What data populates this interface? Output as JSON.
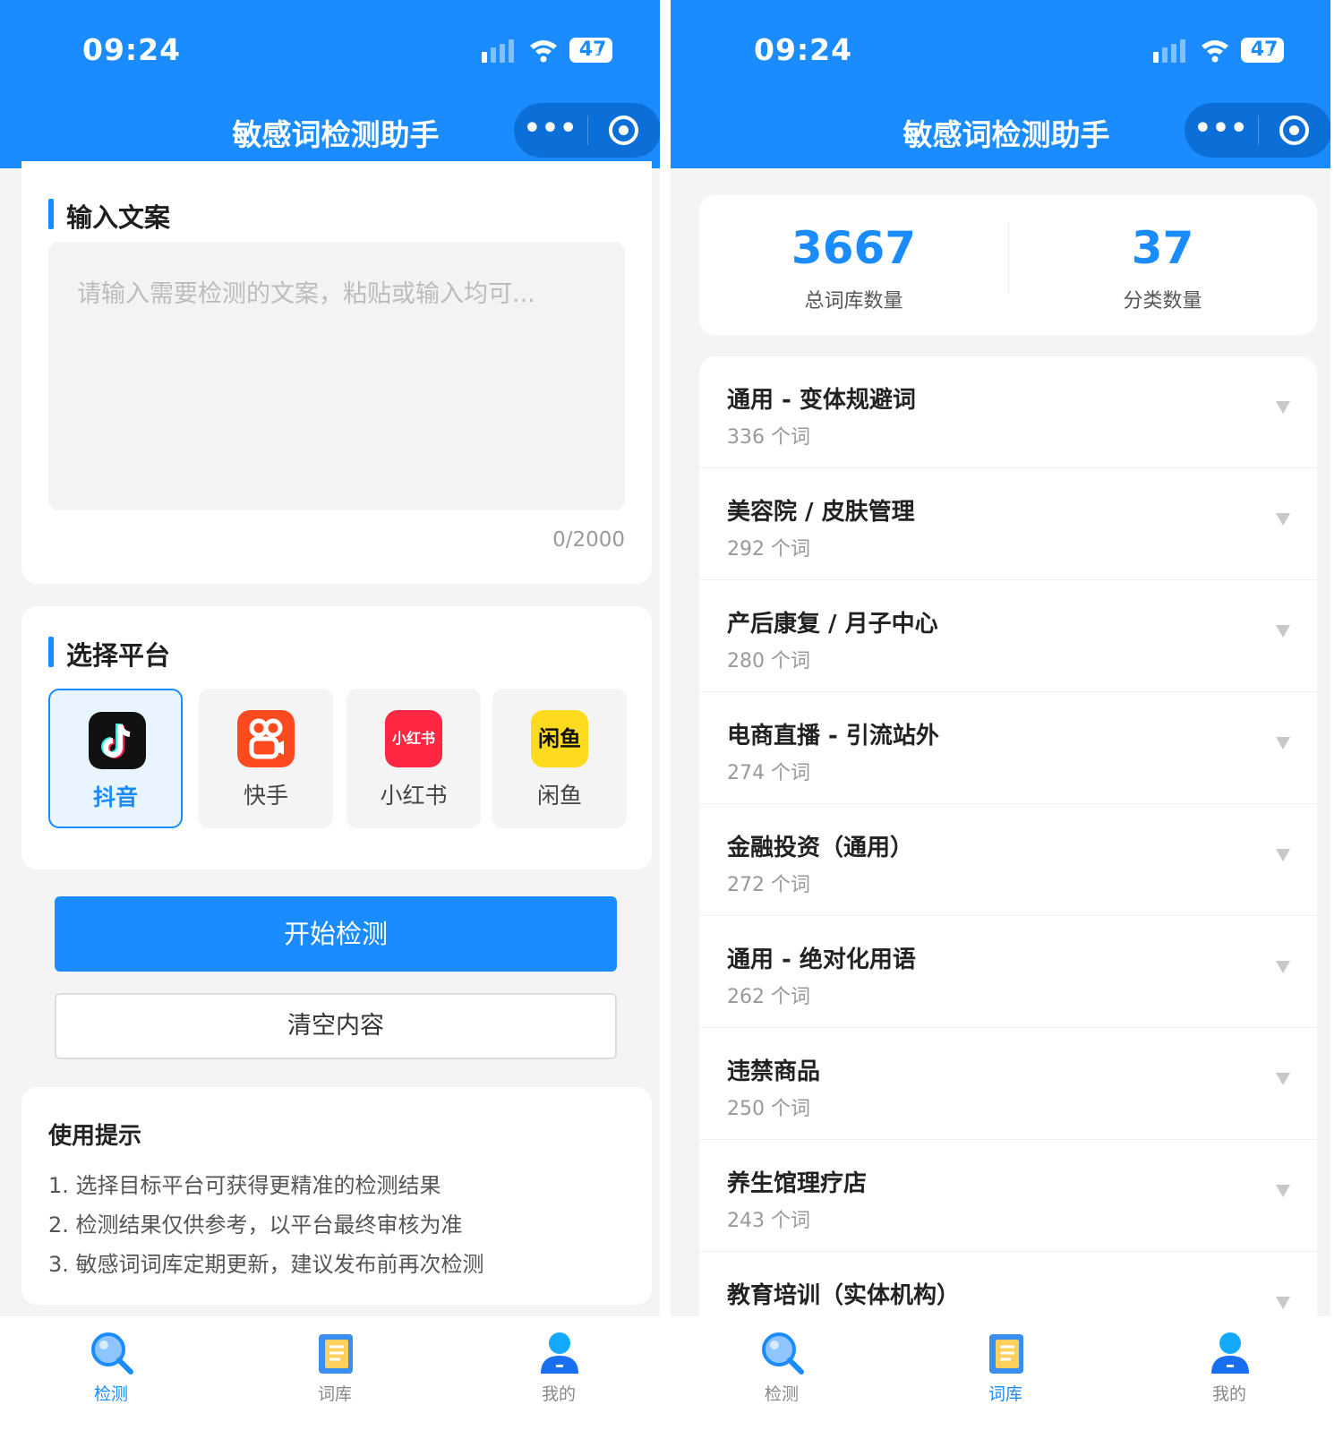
{
  "status": {
    "time": "09:24",
    "battery": "47"
  },
  "app_title": "敏感词检测助手",
  "capsule": {
    "more": "•••"
  },
  "detect": {
    "input_title": "输入文案",
    "placeholder": "请输入需要检测的文案，粘贴或输入均可...",
    "counter": "0/2000",
    "platform_title": "选择平台",
    "platforms": [
      {
        "name": "抖音",
        "icon": "douyin-icon",
        "active": true,
        "color": "#111111"
      },
      {
        "name": "快手",
        "icon": "kuaishou-icon",
        "active": false,
        "color": "#ff4a1f"
      },
      {
        "name": "小红书",
        "icon": "xiaohongshu-icon",
        "active": false,
        "color": "#ff2741",
        "logo_text": "小红书"
      },
      {
        "name": "闲鱼",
        "icon": "xianyu-icon",
        "active": false,
        "color": "#ffdb1f",
        "logo_text": "闲鱼"
      }
    ],
    "start_button": "开始检测",
    "clear_button": "清空内容",
    "tips_title": "使用提示",
    "tips": [
      "1. 选择目标平台可获得更精准的检测结果",
      "2. 检测结果仅供参考，以平台最终审核为准",
      "3. 敏感词词库定期更新，建议发布前再次检测"
    ]
  },
  "library": {
    "total_count": "3667",
    "total_label": "总词库数量",
    "category_count": "37",
    "category_label": "分类数量",
    "categories": [
      {
        "name": "通用 - 变体规避词",
        "count": "336 个词"
      },
      {
        "name": "美容院 / 皮肤管理",
        "count": "292 个词"
      },
      {
        "name": "产后康复 / 月子中心",
        "count": "280 个词"
      },
      {
        "name": "电商直播 - 引流站外",
        "count": "274 个词"
      },
      {
        "name": "金融投资（通用）",
        "count": "272 个词"
      },
      {
        "name": "通用 - 绝对化用语",
        "count": "262 个词"
      },
      {
        "name": "违禁商品",
        "count": "250 个词"
      },
      {
        "name": "养生馆理疗店",
        "count": "243 个词"
      },
      {
        "name": "教育培训（实体机构）",
        "count": ""
      }
    ]
  },
  "tabbar": {
    "tabs": [
      {
        "label": "检测",
        "icon": "search-icon"
      },
      {
        "label": "词库",
        "icon": "book-icon"
      },
      {
        "label": "我的",
        "icon": "user-icon"
      }
    ]
  },
  "colors": {
    "primary": "#1a8cff",
    "background": "#f4f4f5"
  }
}
